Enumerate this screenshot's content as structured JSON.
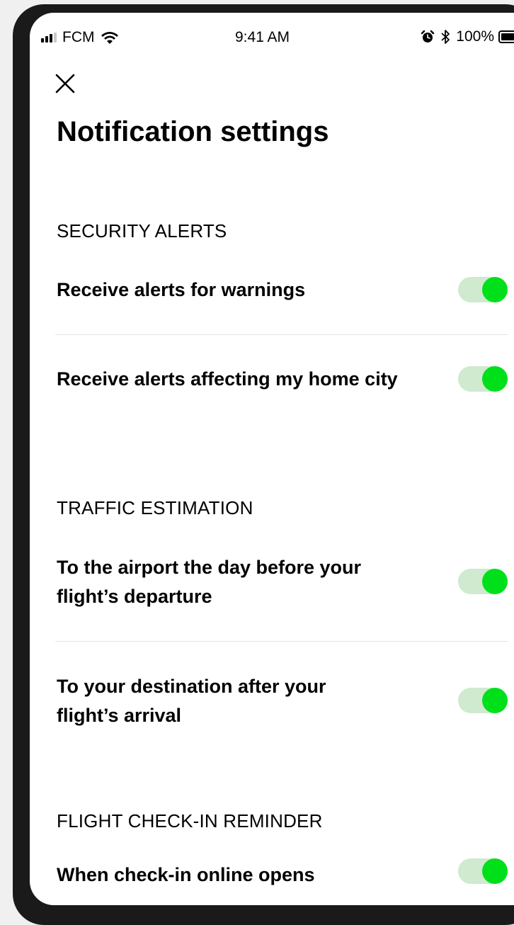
{
  "status_bar": {
    "carrier": "FCM",
    "time": "9:41 AM",
    "battery": "100%",
    "battery_level": 1.0,
    "icons": [
      "signal-icon",
      "wifi-icon",
      "alarm-icon",
      "bluetooth-icon",
      "battery-icon"
    ]
  },
  "header": {
    "close_icon": "close-icon",
    "title": "Notification settings"
  },
  "sections": [
    {
      "header": "SECURITY ALERTS",
      "items": [
        {
          "label": "Receive alerts for warnings",
          "enabled": true
        },
        {
          "label": "Receive alerts affecting my home city",
          "enabled": true
        }
      ]
    },
    {
      "header": "TRAFFIC ESTIMATION",
      "items": [
        {
          "label": "To the airport the day before your flight’s departure",
          "enabled": true
        },
        {
          "label": "To your destination after your flight’s arrival",
          "enabled": true
        }
      ]
    },
    {
      "header": "FLIGHT CHECK-IN REMINDER",
      "items": [
        {
          "label": "When check-in online opens",
          "enabled": true
        }
      ]
    }
  ],
  "colors": {
    "toggle_on_knob": "#00e01a",
    "toggle_on_track": "#cfeacf",
    "divider": "#e6e6e6",
    "text": "#000000"
  }
}
